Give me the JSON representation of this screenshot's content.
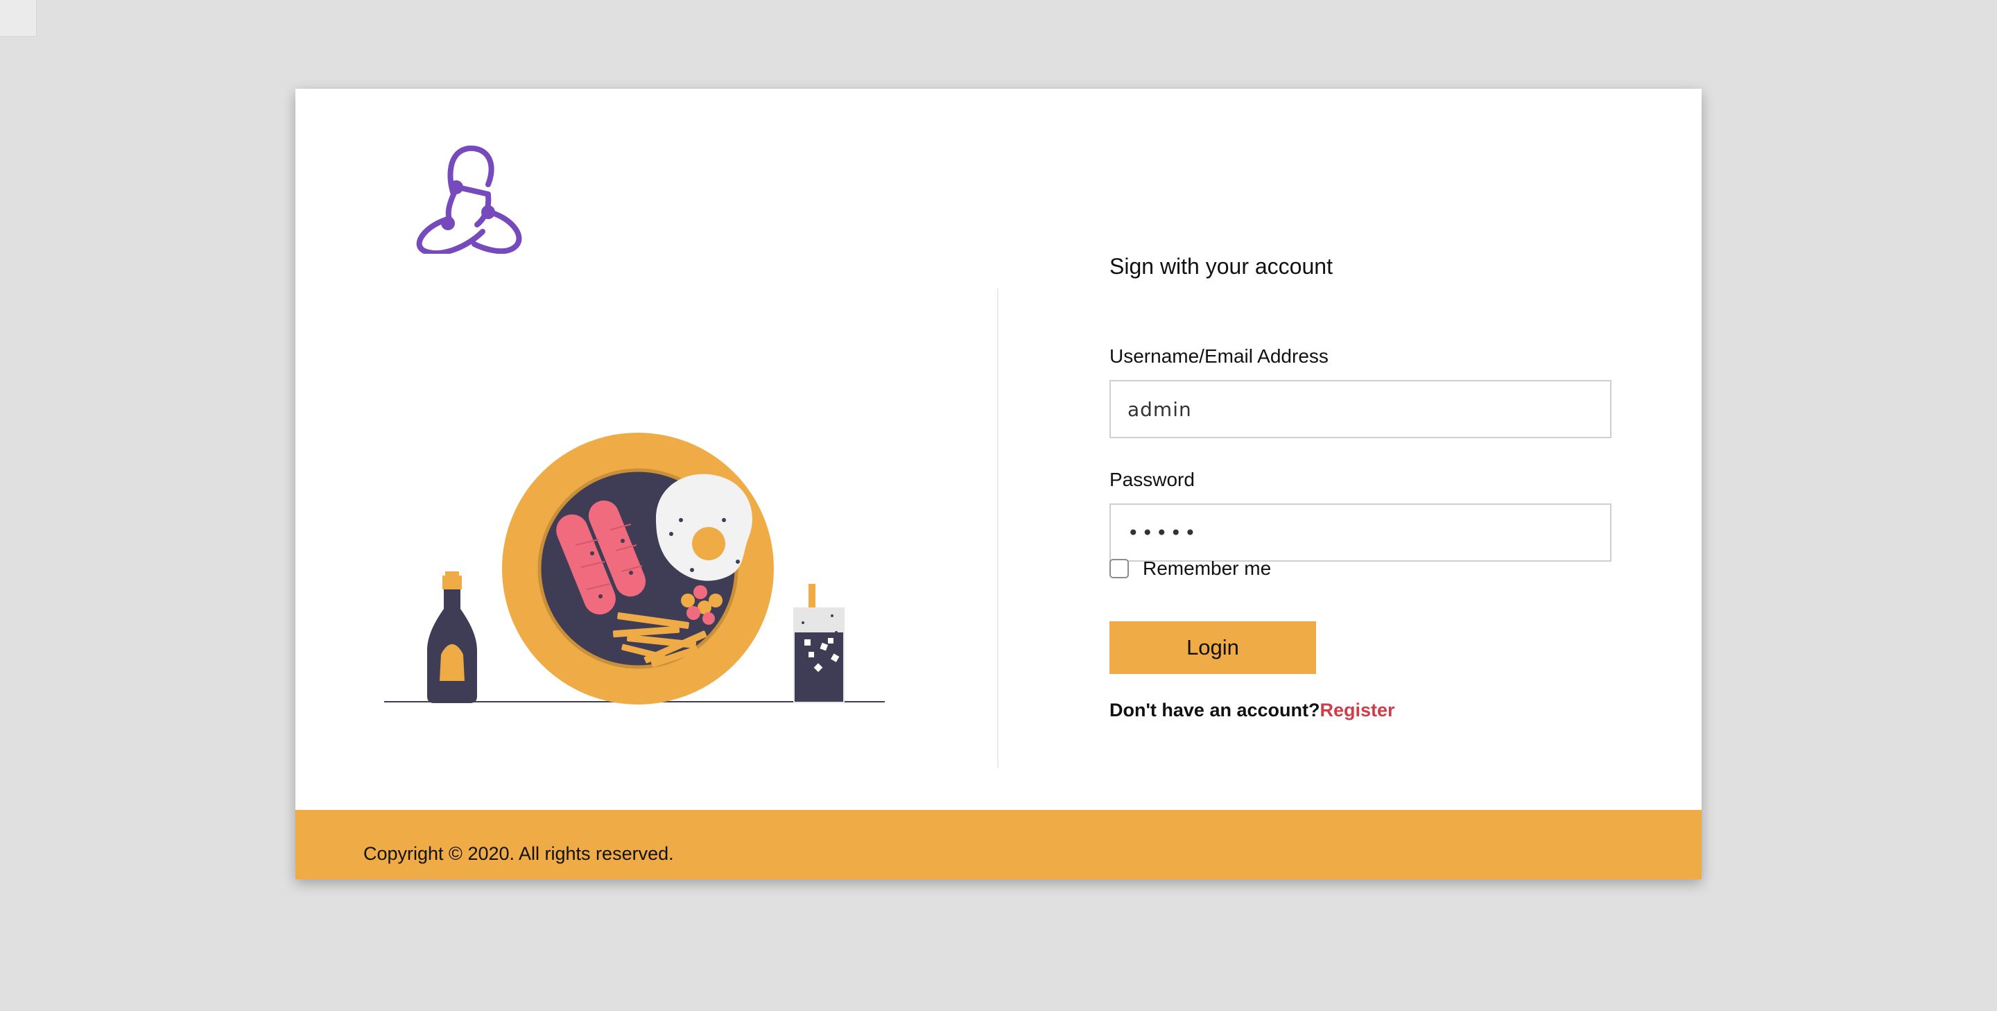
{
  "brand": {
    "logo_icon": "redux-logo-icon",
    "logo_color": "#764abc"
  },
  "illustration": {
    "icon": "breakfast-plate-illustration",
    "colors": {
      "plate": "#efab46",
      "dark": "#3f3d56",
      "sausage": "#f06b7e",
      "egg_white": "#f2f2f2"
    }
  },
  "form": {
    "title": "Sign with your account",
    "username": {
      "label": "Username/Email Address",
      "value": "admin"
    },
    "password": {
      "label": "Password",
      "value": "•••••"
    },
    "remember": {
      "label": "Remember me",
      "checked": false
    },
    "login_label": "Login",
    "register_prompt": "Don't have an account?",
    "register_link": "Register"
  },
  "footer": {
    "copyright": "Copyright © 2020. All rights reserved."
  },
  "colors": {
    "accent": "#efab46",
    "link": "#cf3e48",
    "background": "#e0e0e0"
  }
}
